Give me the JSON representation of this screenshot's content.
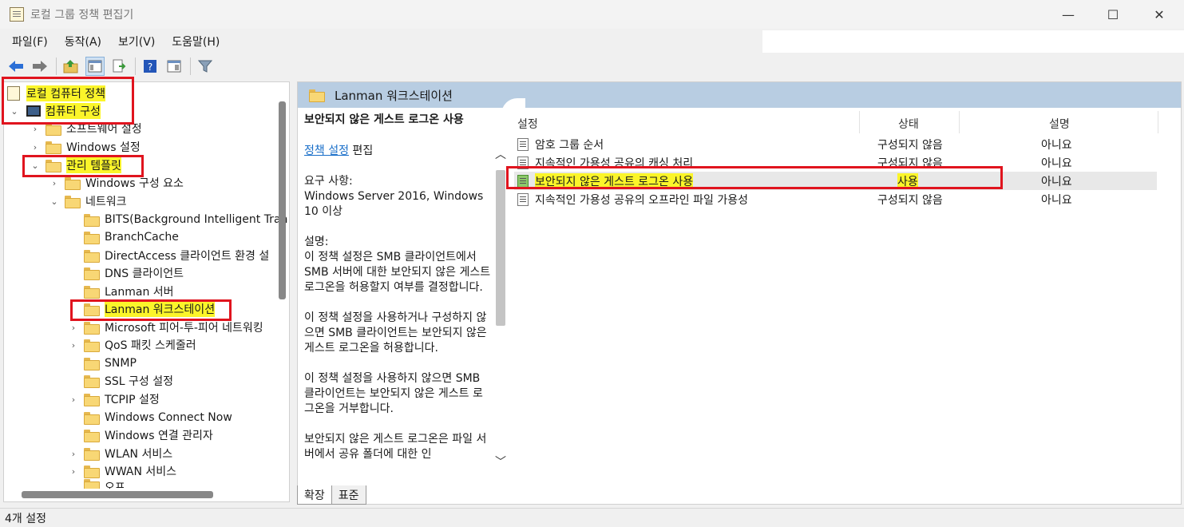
{
  "window": {
    "title": "로컬 그룹 정책 편집기",
    "minimize_glyph": "—",
    "maximize_glyph": "☐",
    "close_glyph": "✕"
  },
  "menu": [
    "파일(F)",
    "동작(A)",
    "보기(V)",
    "도움말(H)"
  ],
  "toolbar": {
    "icons": [
      "back-arrow-icon",
      "forward-arrow-icon",
      "up-folder-icon",
      "show-hide-tree-icon",
      "export-list-icon",
      "help-icon",
      "console-view-icon",
      "filter-icon"
    ]
  },
  "tree": {
    "items": [
      {
        "label": "로컬 컴퓨터 정책",
        "chev": ""
      },
      {
        "label": "컴퓨터 구성",
        "chev": "⌄"
      },
      {
        "label": "소프트웨어 설정",
        "chev": "›"
      },
      {
        "label": "Windows 설정",
        "chev": "›"
      },
      {
        "label": "관리 템플릿",
        "chev": "⌄"
      },
      {
        "label": "Windows 구성 요소",
        "chev": "›"
      },
      {
        "label": "네트워크",
        "chev": "⌄"
      },
      {
        "label": "BITS(Background Intelligent Tran",
        "chev": ""
      },
      {
        "label": "BranchCache",
        "chev": ""
      },
      {
        "label": "DirectAccess 클라이언트 환경 설",
        "chev": ""
      },
      {
        "label": "DNS 클라이언트",
        "chev": ""
      },
      {
        "label": "Lanman 서버",
        "chev": ""
      },
      {
        "label": "Lanman 워크스테이션",
        "chev": ""
      },
      {
        "label": "Microsoft 피어-투-피어 네트워킹",
        "chev": "›"
      },
      {
        "label": "QoS 패킷 스케줄러",
        "chev": "›"
      },
      {
        "label": "SNMP",
        "chev": ""
      },
      {
        "label": "SSL 구성 설정",
        "chev": ""
      },
      {
        "label": "TCPIP 설정",
        "chev": "›"
      },
      {
        "label": "Windows Connect Now",
        "chev": ""
      },
      {
        "label": "Windows 연결 관리자",
        "chev": ""
      },
      {
        "label": "WLAN 서비스",
        "chev": "›"
      },
      {
        "label": "WWAN 서비스",
        "chev": "›"
      },
      {
        "label": "오프",
        "chev": ""
      }
    ]
  },
  "right": {
    "header": "Lanman 워크스테이션",
    "desc": {
      "title": "보안되지 않은 게스트 로그온 사용",
      "edit_link": "정책 설정",
      "edit_suffix": " 편집",
      "req_label": "요구 사항:",
      "req_value": "Windows Server 2016, Windows 10 이상",
      "desc_label": "설명:",
      "p1": "이 정책 설정은 SMB 클라이언트에서 SMB 서버에 대한 보안되지 않은 게스트 로그온을 허용할지 여부를 결정합니다.",
      "p2": "이 정책 설정을 사용하거나 구성하지 않으면 SMB 클라이언트는 보안되지 않은 게스트 로그온을 허용합니다.",
      "p3": "이 정책 설정을 사용하지 않으면 SMB 클라이언트는 보안되지 않은 게스트 로그온을 거부합니다.",
      "p4": "보안되지 않은 게스트 로그온은 파일 서버에서 공유 폴더에 대한 인"
    },
    "columns": [
      "설정",
      "상태",
      "설명"
    ],
    "rows": [
      {
        "name": "암호 그룹 순서",
        "state": "구성되지 않음",
        "comment": "아니요"
      },
      {
        "name": "지속적인 가용성 공유의 캐싱 처리",
        "state": "구성되지 않음",
        "comment": "아니요"
      },
      {
        "name": "보안되지 않은 게스트 로그온 사용",
        "state": "사용",
        "comment": "아니요"
      },
      {
        "name": "지속적인 가용성 공유의 오프라인 파일 가용성",
        "state": "구성되지 않음",
        "comment": "아니요"
      }
    ],
    "tabs": [
      "확장",
      "표준"
    ]
  },
  "status": "4개 설정",
  "colors": {
    "highlight": "#fbf52a",
    "annotation_red": "#e0141e",
    "header_band": "#b8cde2"
  }
}
